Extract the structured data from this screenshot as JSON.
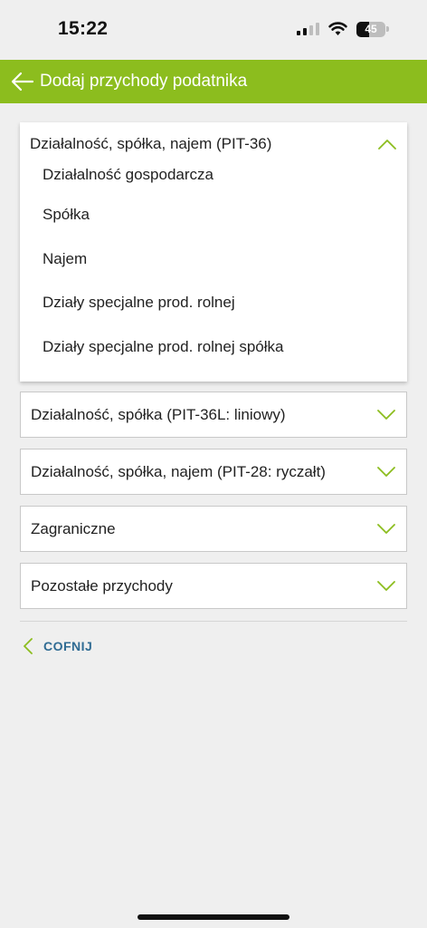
{
  "status_bar": {
    "time": "15:22",
    "battery_level": "45"
  },
  "app_bar": {
    "title": "Dodaj przychody podatnika",
    "color": "#8cbd1e"
  },
  "sections": [
    {
      "title": "Działalność, spółka, najem (PIT-36)",
      "expanded": true,
      "items": [
        "Działalność gospodarcza",
        "Spółka",
        "Najem",
        "Działy specjalne prod. rolnej",
        "Działy specjalne prod. rolnej spółka"
      ]
    },
    {
      "title": "Działalność, spółka (PIT-36L: liniowy)",
      "expanded": false
    },
    {
      "title": "Działalność, spółka, najem (PIT-28: ryczałt)",
      "expanded": false
    },
    {
      "title": "Zagraniczne",
      "expanded": false
    },
    {
      "title": "Pozostałe przychody",
      "expanded": false
    }
  ],
  "back_link": {
    "label": "COFNIJ"
  },
  "icons": {
    "back": "arrow-left-icon",
    "expand": "chevron-down-icon",
    "collapse": "chevron-up-icon",
    "link_back": "chevron-left-icon"
  },
  "colors": {
    "accent": "#8cbd1e",
    "link": "#2f6b93"
  }
}
